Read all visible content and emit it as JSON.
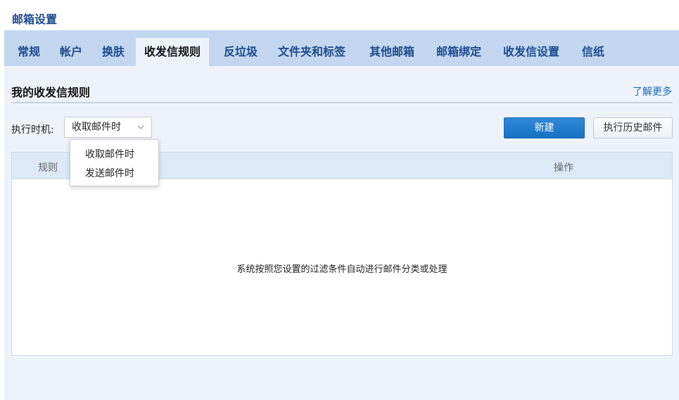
{
  "page": {
    "title": "邮箱设置"
  },
  "tabs": [
    {
      "label": "常规"
    },
    {
      "label": "帐户"
    },
    {
      "label": "换肤"
    },
    {
      "label": "收发信规则",
      "active": true
    },
    {
      "label": "反垃圾"
    },
    {
      "label": "文件夹和标签"
    },
    {
      "label": "其他邮箱"
    },
    {
      "label": "邮箱绑定"
    },
    {
      "label": "收发信设置"
    },
    {
      "label": "信纸"
    }
  ],
  "section": {
    "title": "我的收发信规则",
    "learn_more": "了解更多"
  },
  "filter": {
    "label": "执行时机:",
    "selected": "收取邮件时",
    "options": [
      "收取邮件时",
      "发送邮件时"
    ]
  },
  "buttons": {
    "new": "新建",
    "history": "执行历史邮件"
  },
  "table": {
    "columns": [
      "规则",
      "操作"
    ],
    "empty_text": "系统按照您设置的过滤条件自动进行邮件分类或处理"
  },
  "colors": {
    "accent": "#1670c4",
    "tabbar": "#c3d8f0",
    "content_bg": "#eef3fa"
  }
}
